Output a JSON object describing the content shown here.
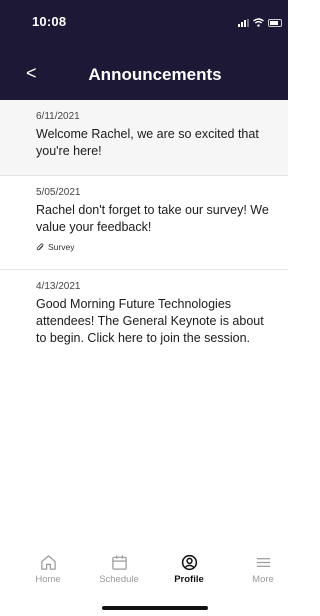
{
  "status": {
    "time": "10:08"
  },
  "header": {
    "title": "Announcements",
    "back_glyph": "<"
  },
  "announcements": [
    {
      "date": "6/11/2021",
      "message": "Welcome Rachel, we are so excited that you're here!"
    },
    {
      "date": "5/05/2021",
      "message": "Rachel don't forget to take our survey! We value your feedback!",
      "attachment": "Survey"
    },
    {
      "date": "4/13/2021",
      "message": "Good Morning Future Technologies attendees! The General Keynote is about to begin. Click here to join the session."
    }
  ],
  "tabs": [
    {
      "label": "Home",
      "icon": "home-icon"
    },
    {
      "label": "Schedule",
      "icon": "calendar-icon"
    },
    {
      "label": "Profile",
      "icon": "profile-icon",
      "active": true
    },
    {
      "label": "More",
      "icon": "menu-icon"
    }
  ],
  "colors": {
    "header_bg": "#1c1836",
    "active_tab": "#111111",
    "inactive_tab": "#9a9a9a"
  }
}
